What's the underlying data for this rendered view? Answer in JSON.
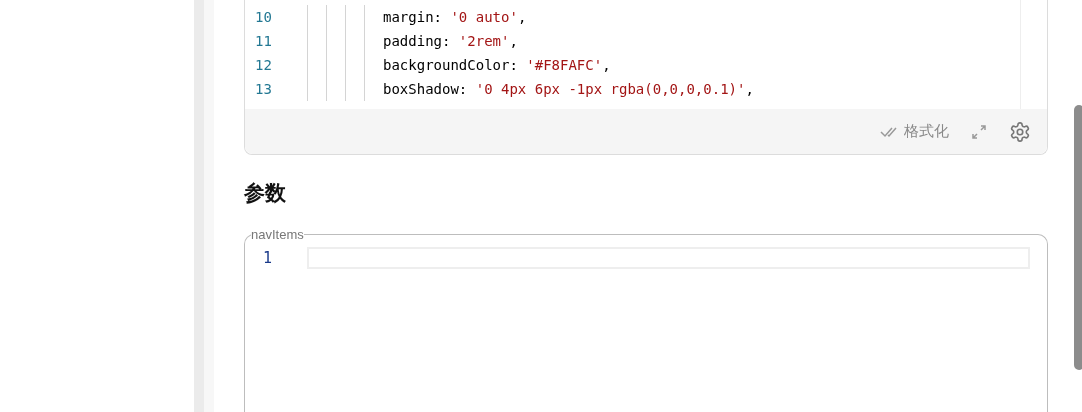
{
  "code_editor": {
    "lines": [
      {
        "number": "10",
        "tokens": [
          {
            "kind": "plain",
            "text": "margin: "
          },
          {
            "kind": "string",
            "text": "'0 auto'"
          },
          {
            "kind": "plain",
            "text": ","
          }
        ]
      },
      {
        "number": "11",
        "tokens": [
          {
            "kind": "plain",
            "text": "padding: "
          },
          {
            "kind": "string",
            "text": "'2rem'"
          },
          {
            "kind": "plain",
            "text": ","
          }
        ]
      },
      {
        "number": "12",
        "tokens": [
          {
            "kind": "plain",
            "text": "backgroundColor: "
          },
          {
            "kind": "string",
            "text": "'#F8FAFC'"
          },
          {
            "kind": "plain",
            "text": ","
          }
        ]
      },
      {
        "number": "13",
        "tokens": [
          {
            "kind": "plain",
            "text": "boxShadow: "
          },
          {
            "kind": "string",
            "text": "'0 4px 6px -1px rgba(0,0,0,0.1)'"
          },
          {
            "kind": "plain",
            "text": ","
          }
        ]
      }
    ],
    "format_button": "格式化"
  },
  "section_title": "参数",
  "param_field": {
    "label": "navItems",
    "lines": [
      {
        "number": "1"
      }
    ]
  }
}
